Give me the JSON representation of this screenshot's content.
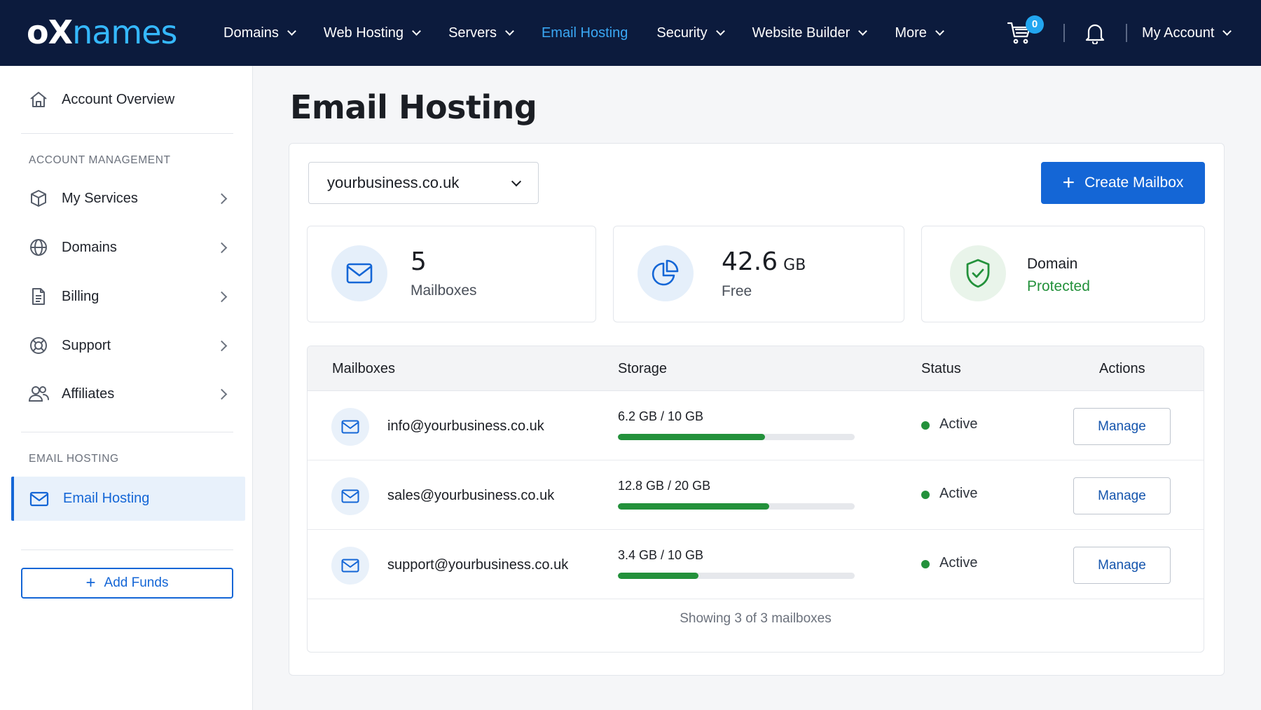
{
  "brand": {
    "logo_part1": "oX",
    "logo_part2": "names"
  },
  "nav": {
    "items": [
      {
        "label": "Domains",
        "dropdown": true
      },
      {
        "label": "Web Hosting",
        "dropdown": true
      },
      {
        "label": "Servers",
        "dropdown": true
      },
      {
        "label": "Email Hosting",
        "dropdown": false,
        "active": true
      },
      {
        "label": "Security",
        "dropdown": true
      },
      {
        "label": "Website Builder",
        "dropdown": true
      },
      {
        "label": "More",
        "dropdown": true
      }
    ],
    "cart_count": "0",
    "account_label": "My Account"
  },
  "sidebar": {
    "overview": "Account Overview",
    "section_account": "ACCOUNT MANAGEMENT",
    "items": [
      {
        "label": "My Services",
        "icon": "box-icon"
      },
      {
        "label": "Domains",
        "icon": "globe-icon"
      },
      {
        "label": "Billing",
        "icon": "document-icon"
      },
      {
        "label": "Support",
        "icon": "lifebuoy-icon"
      },
      {
        "label": "Affiliates",
        "icon": "users-icon"
      }
    ],
    "section_email": "EMAIL HOSTING",
    "active_item": "Email Hosting",
    "add_funds": "Add Funds"
  },
  "main": {
    "title": "Email Hosting",
    "domain_select": "yourbusiness.co.uk",
    "create_button": "Create Mailbox",
    "stats": {
      "mailboxes_value": "5",
      "mailboxes_label": "Mailboxes",
      "storage_value": "42.6",
      "storage_unit": "GB",
      "storage_label": "Free",
      "domain_label": "Domain",
      "domain_status": "Protected"
    },
    "table": {
      "headers": {
        "mailboxes": "Mailboxes",
        "storage": "Storage",
        "status": "Status",
        "actions": "Actions"
      },
      "rows": [
        {
          "email": "info@yourbusiness.co.uk",
          "storage": "6.2 GB / 10 GB",
          "usage_fraction": 0.62,
          "status": "Active",
          "action": "Manage"
        },
        {
          "email": "sales@yourbusiness.co.uk",
          "storage": "12.8 GB / 20 GB",
          "usage_fraction": 0.64,
          "status": "Active",
          "action": "Manage"
        },
        {
          "email": "support@yourbusiness.co.uk",
          "storage": "3.4 GB / 10 GB",
          "usage_fraction": 0.34,
          "status": "Active",
          "action": "Manage"
        }
      ],
      "footer": "Showing 3 of 3 mailboxes"
    }
  },
  "colors": {
    "nav_bg": "#0c1b3d",
    "accent": "#1466d6",
    "active_nav": "#3aa8f5",
    "success": "#23913b"
  }
}
